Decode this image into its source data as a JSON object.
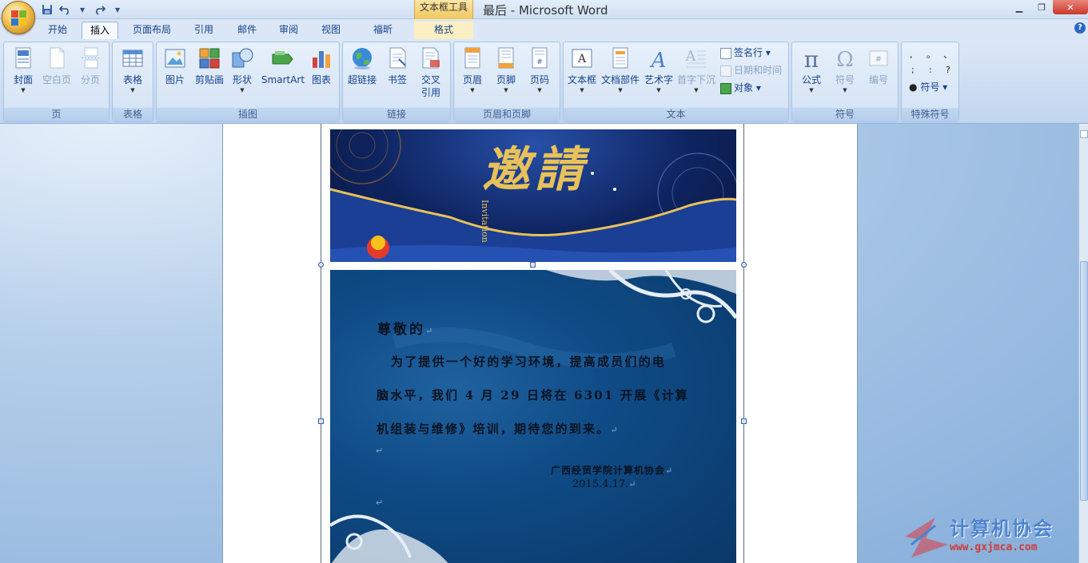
{
  "window": {
    "title": "最后 - Microsoft Word",
    "contextual_tool": "文本框工具"
  },
  "tabs": [
    "开始",
    "插入",
    "页面布局",
    "引用",
    "邮件",
    "审阅",
    "视图",
    "福昕PDF",
    "格式"
  ],
  "active_tab": "插入",
  "ribbon": {
    "groups": {
      "pages": {
        "label": "页",
        "buttons": [
          "封面",
          "空白页",
          "分页"
        ]
      },
      "tables": {
        "label": "表格",
        "buttons": [
          "表格"
        ]
      },
      "illustrations": {
        "label": "插图",
        "buttons": [
          "图片",
          "剪贴画",
          "形状",
          "SmartArt",
          "图表"
        ]
      },
      "links": {
        "label": "链接",
        "buttons": [
          "超链接",
          "书签",
          "交叉",
          "引用"
        ]
      },
      "header_footer": {
        "label": "页眉和页脚",
        "buttons": [
          "页眉",
          "页脚",
          "页码"
        ]
      },
      "text": {
        "label": "文本",
        "buttons": [
          "文本框",
          "文档部件",
          "艺术字",
          "首字下沉"
        ],
        "small": [
          "签名行",
          "日期和时间",
          "对象"
        ]
      },
      "symbols": {
        "label": "符号",
        "buttons": [
          "公式",
          "符号",
          "编号"
        ]
      },
      "special": {
        "label": "特殊符号",
        "chars": [
          ",",
          "。",
          "、",
          ";",
          ":",
          "?"
        ],
        "button": "符号"
      }
    }
  },
  "document": {
    "banner_text": "邀請",
    "banner_sub": "Invitation",
    "greeting": "尊敬的",
    "body_lines": [
      "为了提供一个好的学习环境，提高成员们的电",
      "脑水平，我们 4 月 29 日将在 6301 开展《计算",
      "机组装与维修》培训，期待您的到来。"
    ],
    "signature": "广西经贸学院计算机协会",
    "date": "2015.4.17."
  },
  "watermark": {
    "title": "计算机协会",
    "url": "www.gxjmca.com"
  },
  "colors": {
    "ribbon_text": "#15428b",
    "banner_gold": "#e8c15a",
    "card_bg": "#0f4b86"
  }
}
